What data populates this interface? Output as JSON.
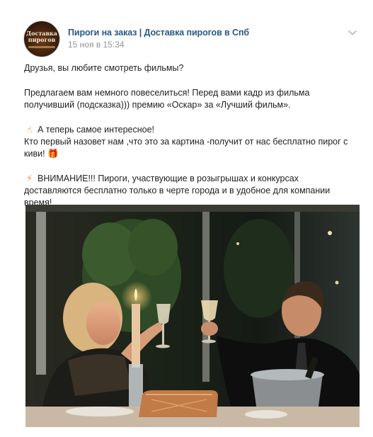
{
  "post": {
    "author": "Пироги на заказ | Доставка пирогов в Спб",
    "date": "15 ноя в 15:34",
    "avatar_logo_text": "Доставка пирогов",
    "paragraphs": {
      "p1": "Друзья, вы любите смотреть фильмы?",
      "p2": "Предлагаем вам немного повеселиться! Перед вами кадр из фильма получивший (подсказка))) премию «Оскар» за «Лучший фильм».",
      "p3_line1": "А теперь самое интересное!",
      "p3_line2": "Кто первый назовет нам ,что это за картина -получит от нас бесплатно пирог с киви!",
      "p4": "ВНИМАНИЕ!!! Пироги, участвующие в розыгрышах и конкурсах доставляются бесплатно только в черте города и в удобное для компании время!"
    },
    "emojis": {
      "hand": "☝",
      "gift": "🎁",
      "bolt": "⚡"
    },
    "icons": {
      "menu": "chevron-down-icon"
    },
    "colors": {
      "author_link": "#2a5885",
      "date": "#939393",
      "text": "#222222"
    }
  }
}
